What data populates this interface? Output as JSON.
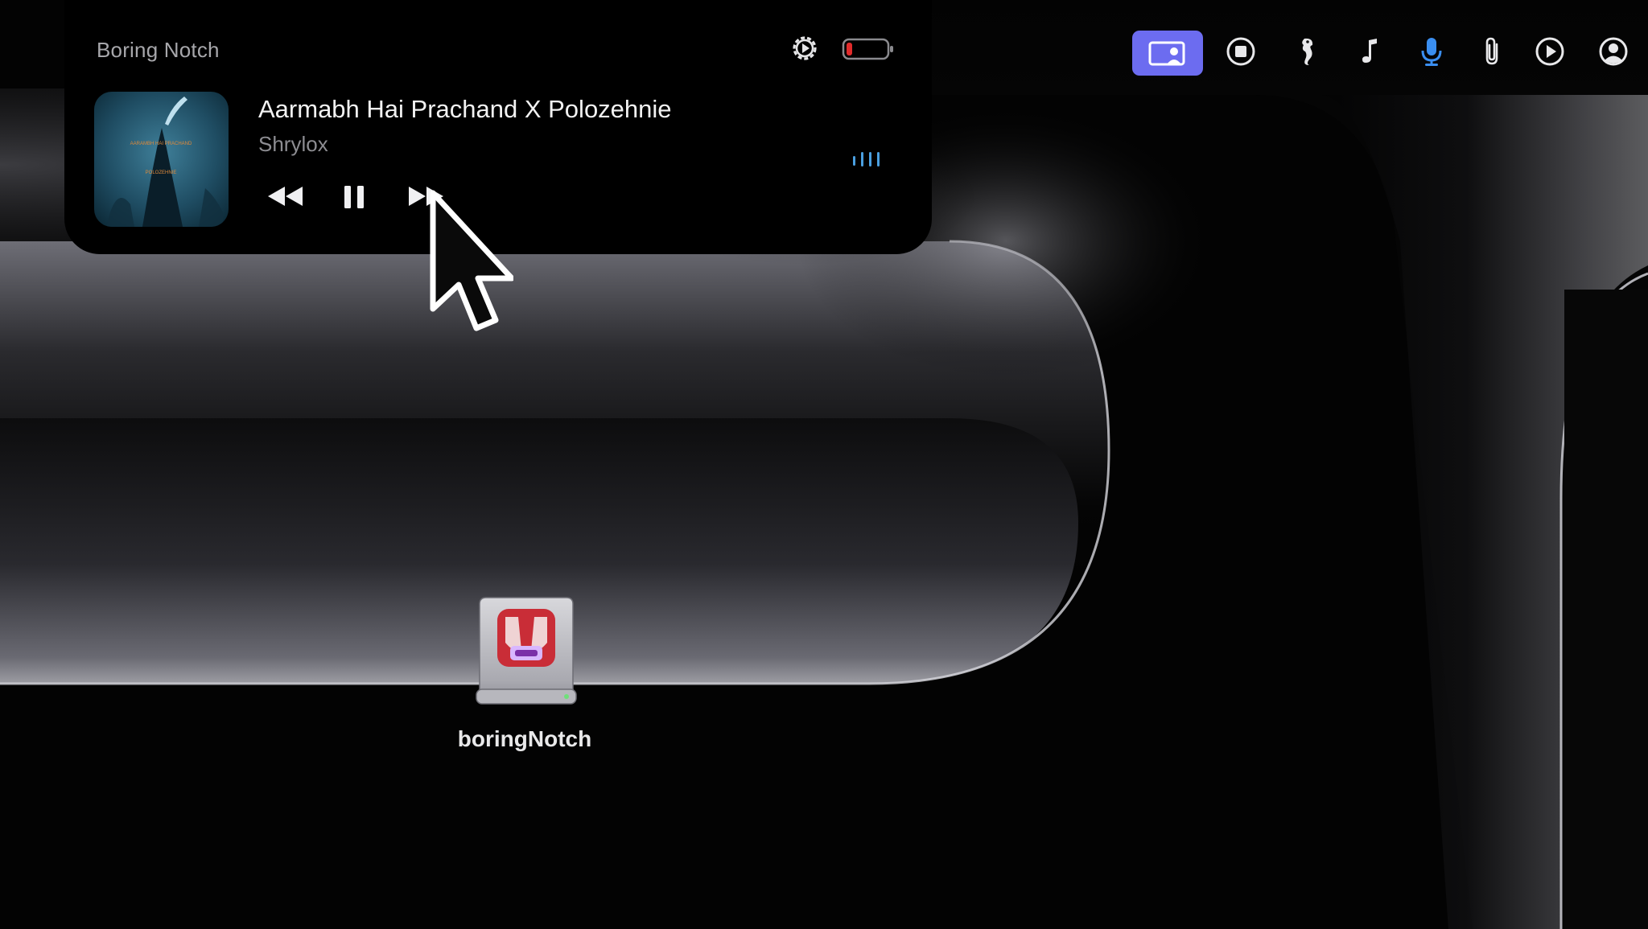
{
  "notch": {
    "app_name": "Boring Notch",
    "now_playing": {
      "title": "Aarmabh Hai Prachand X Polozehnie",
      "artist": "Shrylox"
    },
    "controls": {
      "rewind_icon": "backward-icon",
      "pause_icon": "pause-icon",
      "forward_icon": "forward-icon"
    },
    "status": {
      "settings_icon": "gear-icon",
      "battery_icon": "battery-low-icon",
      "battery_color": "#e02b2b",
      "visualizer_icon": "audio-bars-icon",
      "visualizer_color": "#4a9fe0"
    }
  },
  "menubar": {
    "accent": "#6c6cf0",
    "icons": [
      "screen-share-icon",
      "stop-record-icon",
      "seahorse-icon",
      "music-note-icon",
      "microphone-icon",
      "paperclip-icon",
      "play-circle-icon",
      "user-account-icon"
    ],
    "microphone_color": "#3a8ef0"
  },
  "desktop": {
    "item_label": "boringNotch",
    "item_icon": "disk-image-icon"
  }
}
